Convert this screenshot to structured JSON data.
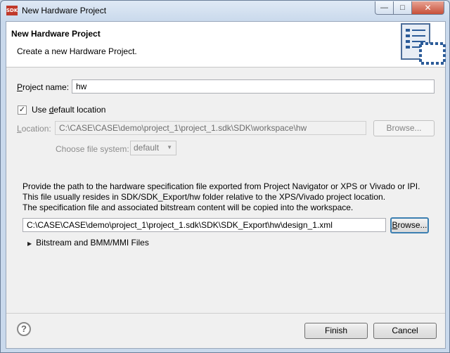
{
  "window": {
    "title": "New Hardware Project",
    "app_icon": "SDK",
    "controls": {
      "minimize": "—",
      "maximize": "□",
      "close": "✕"
    }
  },
  "banner": {
    "title": "New Hardware Project",
    "description": "Create a new Hardware Project.",
    "image_icon": "wizard-document-icon"
  },
  "form": {
    "project_name_label_pre": "P",
    "project_name_label_post": "roject name:",
    "project_name_value": "hw",
    "use_default_checked": true,
    "use_default_label_pre": "Use ",
    "use_default_label_u": "d",
    "use_default_label_post": "efault location",
    "location_label_u": "L",
    "location_label_post": "ocation:",
    "location_value": "C:\\CASE\\CASE\\demo\\project_1\\project_1.sdk\\SDK\\workspace\\hw",
    "location_browse_label": "Browse...",
    "file_system_label": "Choose file system:",
    "file_system_value": "default"
  },
  "spec": {
    "line1": "Provide the path to the hardware specification file exported from Project Navigator or XPS or Vivado or IPI.",
    "line2": "This file usually resides in SDK/SDK_Export/hw folder relative to the XPS/Vivado project location.",
    "line3": "The specification file and associated bitstream content will be copied into the workspace.",
    "path_value": "C:\\CASE\\CASE\\demo\\project_1\\project_1.sdk\\SDK\\SDK_Export\\hw\\design_1.xml",
    "browse_pre": "B",
    "browse_post": "rowse..."
  },
  "bitstream_section": {
    "label": "Bitstream and BMM/MMI Files",
    "expanded": false
  },
  "footer": {
    "help_glyph": "?",
    "finish_label": "Finish",
    "cancel_label": "Cancel"
  }
}
